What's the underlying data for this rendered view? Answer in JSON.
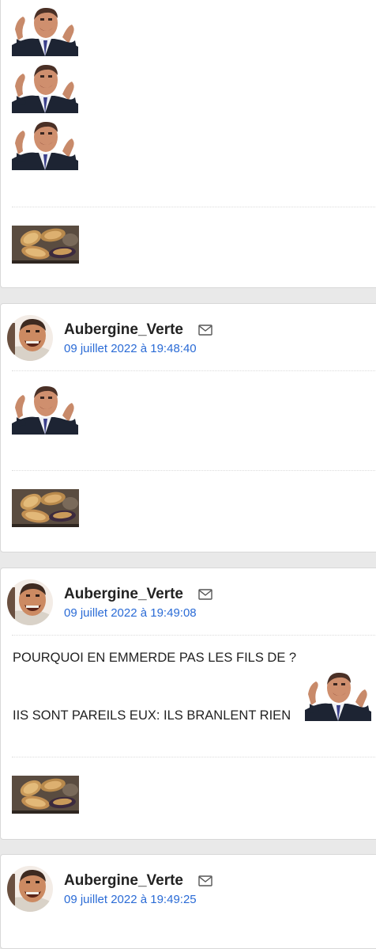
{
  "posts": [
    {
      "author": "Aubergine_Verte",
      "date": "09 juillet 2022 à 19:48:40"
    },
    {
      "author": "Aubergine_Verte",
      "date": "09 juillet 2022 à 19:49:08",
      "lines": [
        "POURQUOI EN EMMERDE PAS LES FILS DE ?",
        "IIS SONT PAREILS EUX: ILS BRANLENT RIEN"
      ]
    },
    {
      "author": "Aubergine_Verte",
      "date": "09 juillet 2022 à 19:49:25"
    }
  ],
  "icons": {
    "mail": "envelope-icon",
    "sticker": "risitas-sticker-icon",
    "signature": "eggplant-image"
  },
  "colors": {
    "link": "#2a6bd6",
    "background": "#e9e9e9",
    "card": "#ffffff"
  }
}
